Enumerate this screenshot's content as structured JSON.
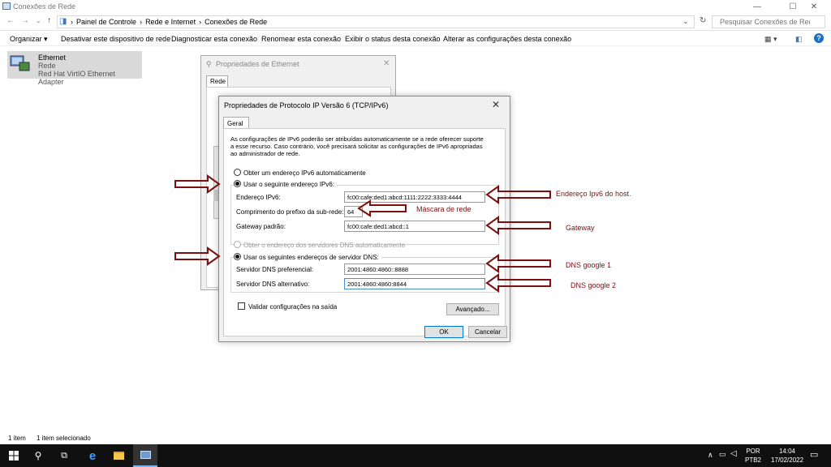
{
  "window": {
    "title": "Conexões de Rede"
  },
  "address": {
    "crumbs": [
      "Painel de Controle",
      "Rede e Internet",
      "Conexões de Rede"
    ],
    "search_placeholder": "Pesquisar Conexões de Rede"
  },
  "commands": [
    "Organizar ▾",
    "Desativar este dispositivo de rede",
    "Diagnosticar esta conexão",
    "Renomear esta conexão",
    "Exibir o status desta conexão",
    "Alterar as configurações desta conexão"
  ],
  "adapter": {
    "name": "Ethernet",
    "network": "Rede",
    "device": "Red Hat VirtIO Ethernet Adapter"
  },
  "eth_dialog": {
    "title": "Propriedades de Ethernet",
    "tab": "Rede"
  },
  "ip_dialog": {
    "title": "Propriedades de Protocolo IP Versão 6 (TCP/IPv6)",
    "tab": "Geral",
    "description": "As configurações de IPv6 poderão ser atribuídas automaticamente se a rede oferecer suporte a esse recurso. Caso contrário, você precisará solicitar as configurações de IPv6 apropriadas ao administrador de rede.",
    "opt_auto_ip": "Obter um endereço IPv6 automaticamente",
    "opt_manual_ip": "Usar o seguinte endereço IPv6:",
    "label_ip": "Endereço IPv6:",
    "label_prefix": "Comprimento do prefixo da sub-rede:",
    "label_gateway": "Gateway padrão:",
    "value_ip": "fc00:cafe:ded1:abcd:1111:2222:3333:4444",
    "value_prefix": "64",
    "value_gateway": "fc00:cafe:ded1:abcd::1",
    "opt_auto_dns": "Obter o endereço dos servidores DNS automaticamente",
    "opt_manual_dns": "Usar os seguintes endereços de servidor DNS:",
    "label_dns1": "Servidor DNS preferencial:",
    "label_dns2": "Servidor DNS alternativo:",
    "value_dns1": "2001:4860:4860::8888",
    "value_dns2": "2001:4860:4860:8844",
    "validate": "Validar configurações na saída",
    "advanced": "Avançado...",
    "ok": "OK",
    "cancel": "Cancelar"
  },
  "annotations": {
    "ip": "Endereço Ipv6 do host.",
    "mask": "Máscara de rede",
    "gateway": "Gateway",
    "dns1": "DNS google 1",
    "dns2": "DNS google 2"
  },
  "status": {
    "count": "1 item",
    "selected": "1 item selecionado"
  },
  "tray": {
    "lang1": "POR",
    "lang2": "PTB2",
    "time": "14:04",
    "date": "17/02/2022"
  },
  "colors": {
    "annotation": "#7b1010",
    "taskbar": "#101010",
    "selected_item": "#d9d9d9"
  }
}
